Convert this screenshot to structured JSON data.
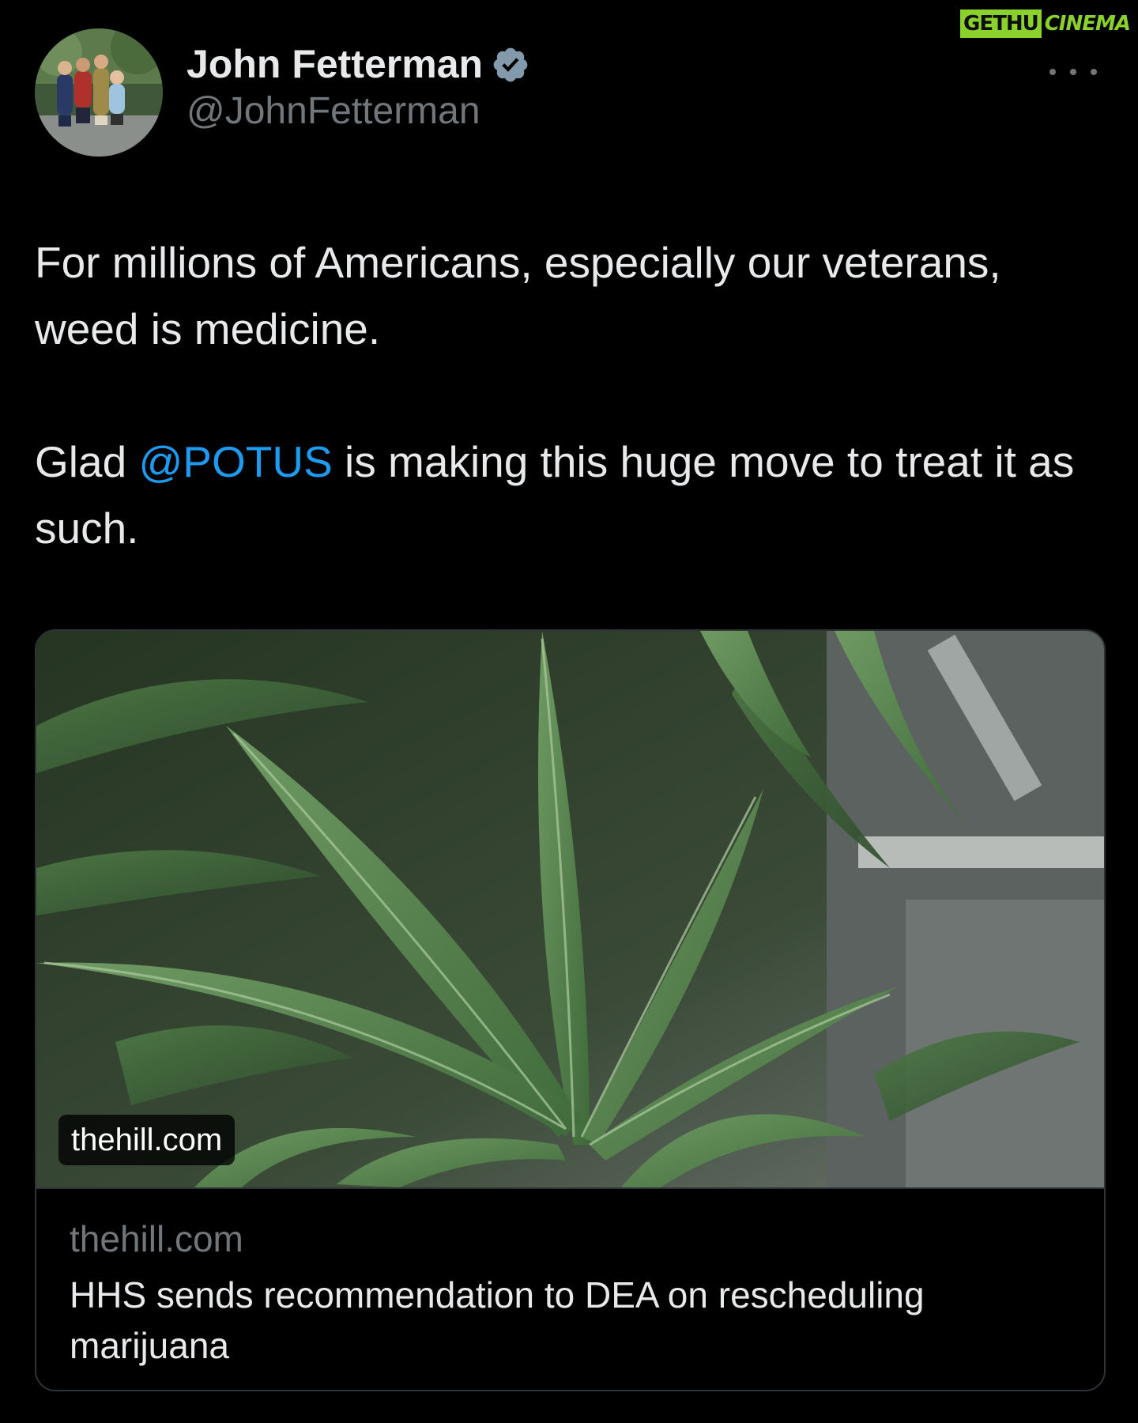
{
  "watermark": {
    "part_a": "GETHU",
    "part_b": "CINEMA"
  },
  "author": {
    "display_name": "John Fetterman",
    "handle": "@JohnFetterman",
    "verified_icon": "verified-badge-icon",
    "avatar_icon": "family-photo-avatar"
  },
  "more_icon": "more-dots-icon",
  "tweet": {
    "line1": "For millions of Americans, especially our veterans, weed is medicine.",
    "line2_before": "Glad ",
    "line2_mention": "@POTUS",
    "line2_after": " is making this huge move to treat it as such."
  },
  "card": {
    "image_badge": "thehill.com",
    "domain": "thehill.com",
    "title": "HHS sends recommendation to DEA on rescheduling marijuana"
  },
  "colors": {
    "background": "#000000",
    "text": "#e7e9ea",
    "muted": "#71767b",
    "mention": "#1d9bf0",
    "border": "#2f3336",
    "verified": "#829aab",
    "watermark": "#8bd12b"
  }
}
